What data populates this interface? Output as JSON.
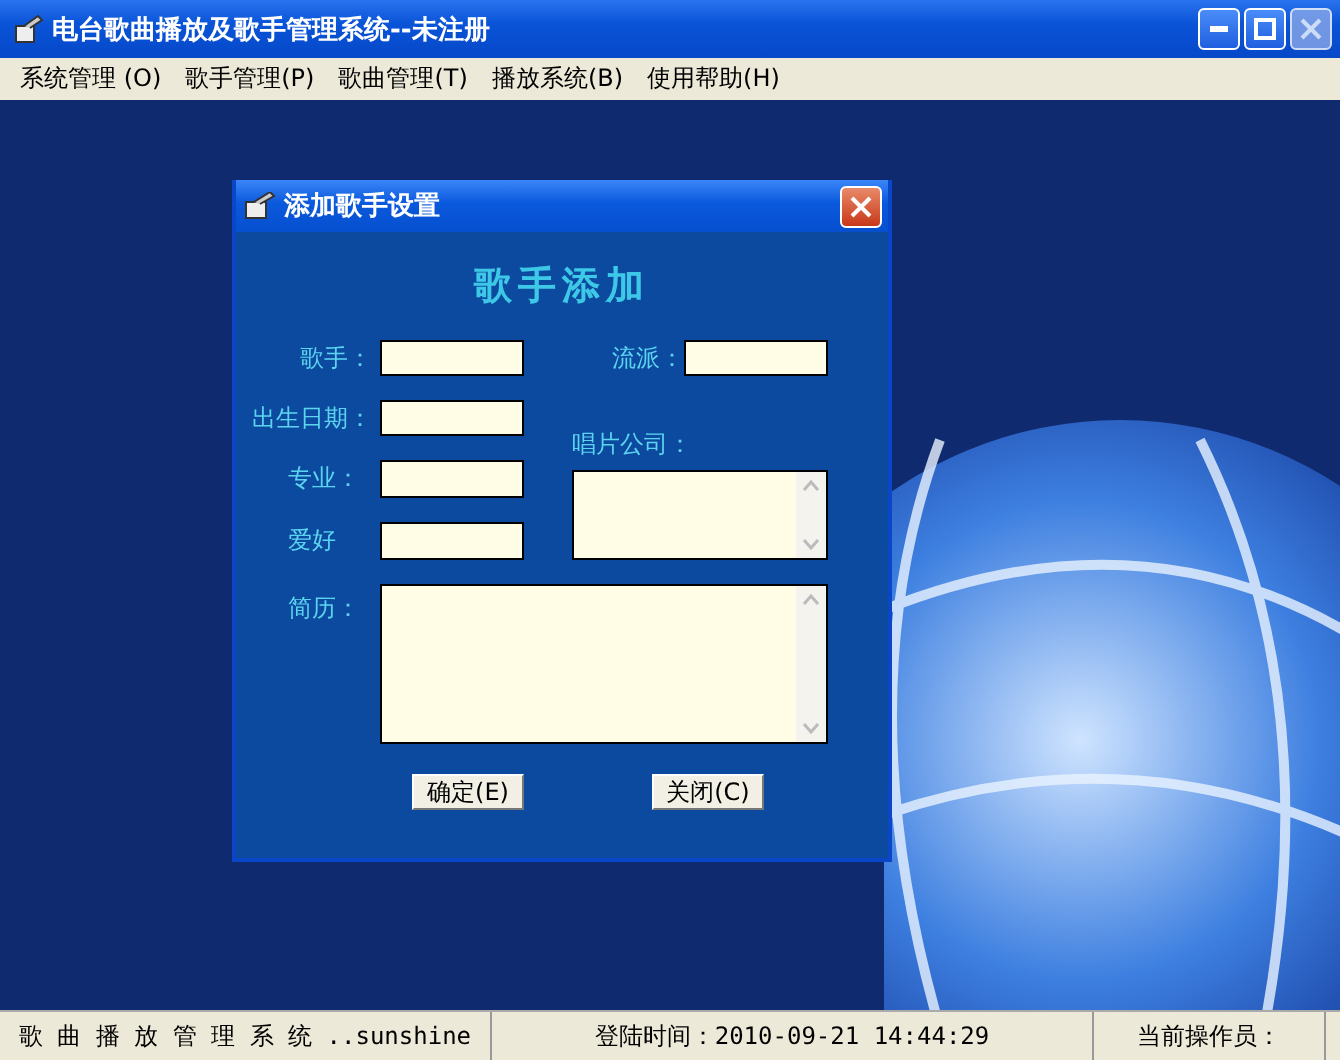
{
  "window": {
    "title": "电台歌曲播放及歌手管理系统--未注册",
    "close_disabled": true
  },
  "menu": [
    "系统管理 (O)",
    "歌手管理(P)",
    "歌曲管理(T)",
    "播放系统(B)",
    "使用帮助(H)"
  ],
  "dialog": {
    "title": "添加歌手设置",
    "heading": "歌手添加",
    "fields": {
      "singer": {
        "label": "歌手："
      },
      "genre": {
        "label": "流派："
      },
      "birth_date": {
        "label": "出生日期："
      },
      "company": {
        "label": "唱片公司："
      },
      "major": {
        "label": "专业："
      },
      "hobby": {
        "label": "爱好"
      },
      "resume": {
        "label": "简历："
      }
    },
    "buttons": [
      "确定(E)",
      "关闭(C)"
    ]
  },
  "status_bar": [
    "歌 曲 播 放 管 理 系 统 ..sunshine",
    "登陆时间：2010-09-21 14:44:29",
    "当前操作员："
  ]
}
